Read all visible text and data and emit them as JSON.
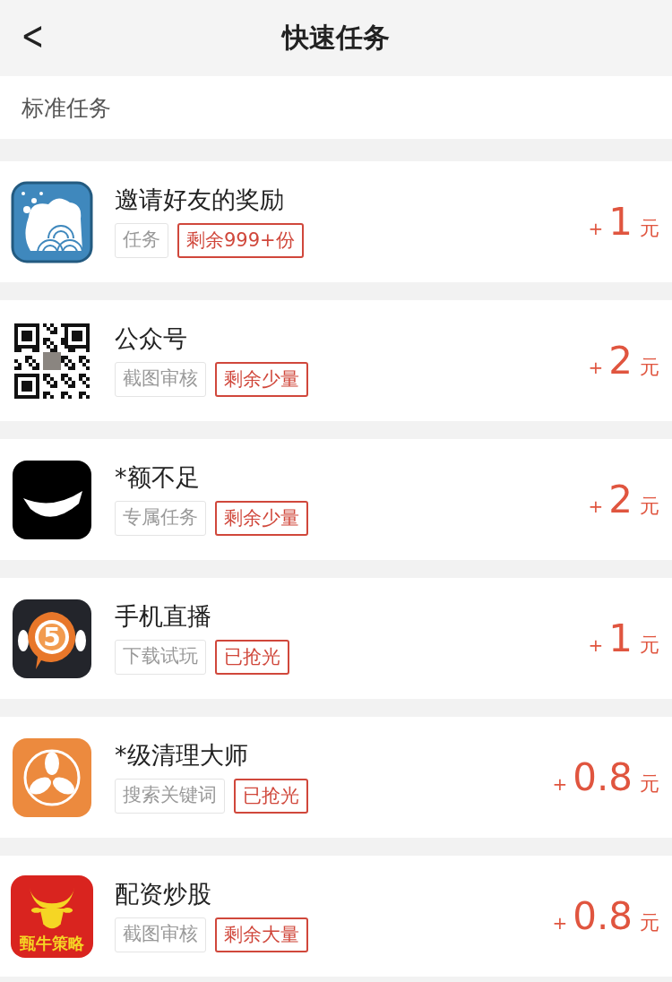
{
  "header": {
    "back": "<",
    "title": "快速任务"
  },
  "section": "标准任务",
  "tasks": [
    {
      "icon": {
        "kind": "waves"
      },
      "title": "邀请好友的奖励",
      "tags": [
        {
          "text": "任务",
          "kind": "plain"
        },
        {
          "text": "剩余999+份",
          "kind": "status"
        }
      ],
      "reward": {
        "plus": "+",
        "amount": "1",
        "unit": "元"
      }
    },
    {
      "icon": {
        "kind": "qr"
      },
      "title": "公众号",
      "tags": [
        {
          "text": "截图审核",
          "kind": "plain"
        },
        {
          "text": "剩余少量",
          "kind": "status"
        }
      ],
      "reward": {
        "plus": "+",
        "amount": "2",
        "unit": "元"
      }
    },
    {
      "icon": {
        "kind": "film"
      },
      "title": "*额不足",
      "tags": [
        {
          "text": "专属任务",
          "kind": "plain"
        },
        {
          "text": "剩余少量",
          "kind": "status"
        }
      ],
      "reward": {
        "plus": "+",
        "amount": "2",
        "unit": "元"
      }
    },
    {
      "icon": {
        "kind": "live",
        "text": "5"
      },
      "title": "手机直播",
      "tags": [
        {
          "text": "下载试玩",
          "kind": "plain"
        },
        {
          "text": "已抢光",
          "kind": "status"
        }
      ],
      "reward": {
        "plus": "+",
        "amount": "1",
        "unit": "元"
      }
    },
    {
      "icon": {
        "kind": "fan"
      },
      "title": "*级清理大师",
      "tags": [
        {
          "text": "搜索关键词",
          "kind": "plain"
        },
        {
          "text": "已抢光",
          "kind": "status"
        }
      ],
      "reward": {
        "plus": "+",
        "amount": "0.8",
        "unit": "元"
      }
    },
    {
      "icon": {
        "kind": "bull",
        "text": "甄牛策略"
      },
      "title": "配资炒股",
      "tags": [
        {
          "text": "截图审核",
          "kind": "plain"
        },
        {
          "text": "剩余大量",
          "kind": "status"
        }
      ],
      "reward": {
        "plus": "+",
        "amount": "0.8",
        "unit": "元"
      }
    }
  ]
}
